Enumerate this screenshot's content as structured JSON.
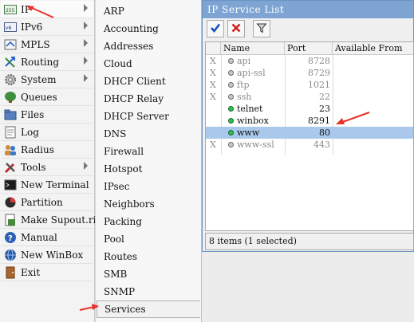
{
  "main_menu": {
    "items": [
      {
        "label": "IP",
        "icon": "ip-icon",
        "has_submenu": true,
        "active": true
      },
      {
        "label": "IPv6",
        "icon": "ipv6-icon",
        "has_submenu": true
      },
      {
        "label": "MPLS",
        "icon": "mpls-icon",
        "has_submenu": true
      },
      {
        "label": "Routing",
        "icon": "routing-icon",
        "has_submenu": true
      },
      {
        "label": "System",
        "icon": "gear-icon",
        "has_submenu": true
      },
      {
        "label": "Queues",
        "icon": "queues-icon",
        "has_submenu": false
      },
      {
        "label": "Files",
        "icon": "folder-icon",
        "has_submenu": false
      },
      {
        "label": "Log",
        "icon": "log-icon",
        "has_submenu": false
      },
      {
        "label": "Radius",
        "icon": "radius-icon",
        "has_submenu": false
      },
      {
        "label": "Tools",
        "icon": "tools-icon",
        "has_submenu": true
      },
      {
        "label": "New Terminal",
        "icon": "terminal-icon",
        "has_submenu": false
      },
      {
        "label": "Partition",
        "icon": "partition-icon",
        "has_submenu": false
      },
      {
        "label": "Make Supout.rif",
        "icon": "supout-icon",
        "has_submenu": false
      },
      {
        "label": "Manual",
        "icon": "help-icon",
        "has_submenu": false
      },
      {
        "label": "New WinBox",
        "icon": "winbox-icon",
        "has_submenu": false
      },
      {
        "label": "Exit",
        "icon": "exit-icon",
        "has_submenu": false
      }
    ]
  },
  "ip_submenu": {
    "items": [
      "ARP",
      "Accounting",
      "Addresses",
      "Cloud",
      "DHCP Client",
      "DHCP Relay",
      "DHCP Server",
      "DNS",
      "Firewall",
      "Hotspot",
      "IPsec",
      "Neighbors",
      "Packing",
      "Pool",
      "Routes",
      "SMB",
      "SNMP",
      "Services"
    ],
    "highlighted": "Services"
  },
  "service_window": {
    "title": "IP Service List",
    "toolbar": {
      "enable": "enable-check-icon",
      "disable": "disable-x-icon",
      "filter": "filter-icon"
    },
    "columns": [
      "Name",
      "Port",
      "Available From"
    ],
    "rows": [
      {
        "disabled_flag": "X",
        "name": "api",
        "port": "8728",
        "enabled": false
      },
      {
        "disabled_flag": "X",
        "name": "api-ssl",
        "port": "8729",
        "enabled": false
      },
      {
        "disabled_flag": "X",
        "name": "ftp",
        "port": "1021",
        "enabled": false
      },
      {
        "disabled_flag": "X",
        "name": "ssh",
        "port": "22",
        "enabled": false
      },
      {
        "disabled_flag": "",
        "name": "telnet",
        "port": "23",
        "enabled": true
      },
      {
        "disabled_flag": "",
        "name": "winbox",
        "port": "8291",
        "enabled": true
      },
      {
        "disabled_flag": "",
        "name": "www",
        "port": "80",
        "enabled": true,
        "selected": true
      },
      {
        "disabled_flag": "X",
        "name": "www-ssl",
        "port": "443",
        "enabled": false
      }
    ],
    "status": "8 items (1 selected)"
  },
  "colors": {
    "title_bar": "#7ea4d3",
    "selected_row": "#aac8ec",
    "annotation_arrow": "#e8322a",
    "enabled_dot": "#2bc24b"
  }
}
